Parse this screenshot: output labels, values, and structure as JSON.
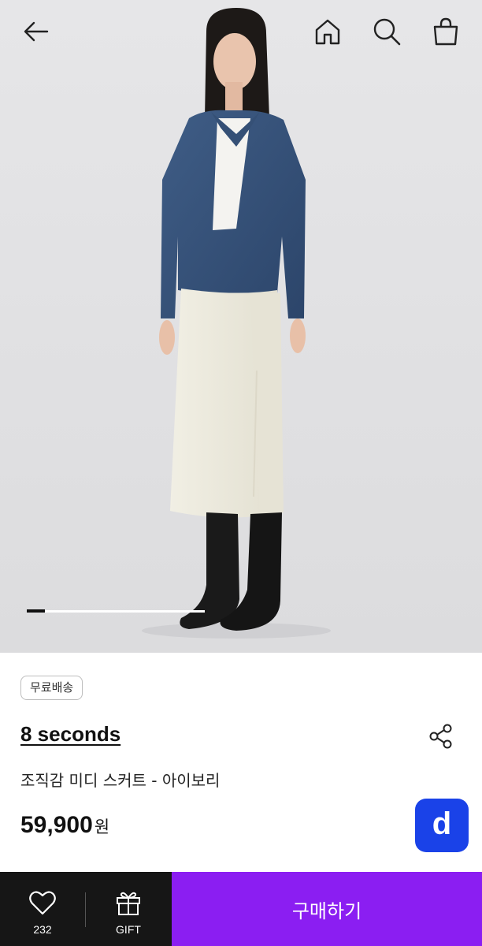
{
  "header": {
    "back_icon": "arrow-left-icon",
    "home_icon": "home-icon",
    "search_icon": "search-icon",
    "cart_icon": "shopping-bag-icon"
  },
  "gallery": {
    "image": "model wearing denim shirt jacket, ivory midi skirt and black boots",
    "progress": 0.1
  },
  "product": {
    "badge": "무료배송",
    "brand": "8 seconds",
    "share_icon": "share-icon",
    "title": "조직감 미디 스커트 - 아이보리",
    "price": "59,900",
    "currency": "원",
    "fab_label": "d"
  },
  "bottom_bar": {
    "like_count": "232",
    "gift_label": "GIFT",
    "buy_label": "구매하기"
  },
  "colors": {
    "buy_button": "#8b1ef2",
    "bottom_left": "#161616",
    "fab": "#1a42e8",
    "hero_background": "#e4e4e6"
  }
}
